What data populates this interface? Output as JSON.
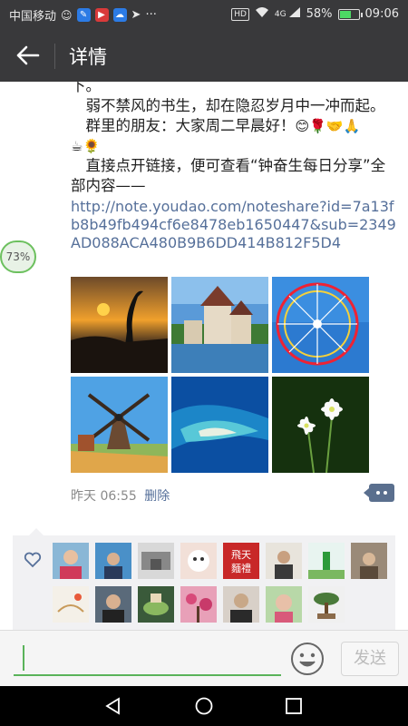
{
  "status_bar": {
    "carrier": "中国移动",
    "network": "4G",
    "battery": "58%",
    "time": "09:06",
    "more_glyph": "···",
    "hd_label": "HD"
  },
  "header": {
    "title": "详情"
  },
  "post": {
    "line1": "下。",
    "line2": "　弱不禁风的书生，却在隐忍岁月中一冲而起。",
    "line3": "　群里的朋友：大家周二早晨好！",
    "emojis_line3": [
      "😊",
      "🌹",
      "🤝",
      "🙏"
    ],
    "emojis_line4": [
      "☕",
      "🌻"
    ],
    "line5": "　直接点开链接，便可查看“钟奋生每日分享”全部内容——",
    "link": "http://note.youdao.com/noteshare?id=7a13fb8b49fb494cf6e8478eb1650447&sub=2349AD088ACA480B9B6DD414B812F5D4",
    "timestamp": "昨天 06:55",
    "delete_label": "删除"
  },
  "floating_badge": "73%",
  "photos": [
    {
      "name": "sunset-crane-photo"
    },
    {
      "name": "castle-lake-photo"
    },
    {
      "name": "ferris-wheel-photo"
    },
    {
      "name": "windmill-photo"
    },
    {
      "name": "coral-island-photo"
    },
    {
      "name": "white-flowers-photo"
    }
  ],
  "likers_row1": [
    "liker-1",
    "liker-2",
    "liker-3",
    "liker-4",
    "liker-5",
    "liker-6",
    "liker-7",
    "liker-8"
  ],
  "likers_row2": [
    "liker-9",
    "liker-10",
    "liker-11",
    "liker-12",
    "liker-13",
    "liker-14",
    "liker-15"
  ],
  "liker_seal_text": "飛天麵禮",
  "input": {
    "value": "",
    "send_label": "发送"
  },
  "colors": {
    "bar": "#39393b",
    "link": "#56709a",
    "accent_green": "#5ab35a"
  }
}
